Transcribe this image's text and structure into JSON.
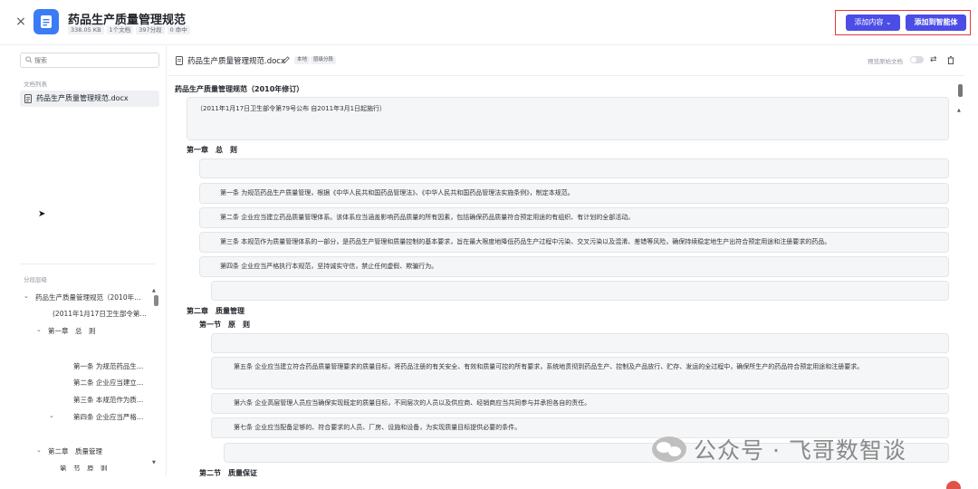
{
  "header": {
    "close": "×",
    "title": "药品生产质量管理规范",
    "meta": [
      "338.05 KB",
      "1个文档",
      "397分段",
      "0 命中"
    ],
    "add_content_label": "添加内容 ⌄",
    "add_agent_label": "添加到智能体"
  },
  "left": {
    "search_placeholder": "搜索",
    "doc_list_label": "文档列表",
    "doc_name": "药品生产质量管理规范.docx",
    "segment_label": "分段层级",
    "tree": [
      "药品生产质量管理规范（2010年…",
      "(2011年1月17日卫生部令第…",
      "第一章　总　则",
      "第一条 为规范药品生…",
      "第二条 企业应当建立…",
      "第三条 本规范作为质…",
      "第四条 企业应当严格…",
      "第二章　质量管理",
      "第　节　原　则"
    ]
  },
  "main": {
    "file_name": "药品生产质量管理规范.docx",
    "tag_local": "本地",
    "tag_level": "层级分段",
    "preview_label": "预览原始文档",
    "doc_title": "药品生产质量管理规范（2010年修订）",
    "intro": "（2011年1月17日卫生部令第79号公布 自2011年3月1日起施行）",
    "ch1": "第一章　总　则",
    "a1": "第一条 为规范药品生产质量管理，根据《中华人民共和国药品管理法》、《中华人民共和国药品管理法实施条例》，制定本规范。",
    "a2": "第二条 企业应当建立药品质量管理体系。该体系应当涵盖影响药品质量的所有因素，包括确保药品质量符合预定用途的有组织、有计划的全部活动。",
    "a3": "第三条 本规范作为质量管理体系的一部分，是药品生产管理和质量控制的基本要求，旨在最大限度地降低药品生产过程中污染、交叉污染以及混淆、差错等风险，确保持续稳定地生产出符合预定用途和注册要求的药品。",
    "a4": "第四条 企业应当严格执行本规范，坚持诚实守信，禁止任何虚假、欺骗行为。",
    "ch2": "第二章　质量管理",
    "sec1": "第一节　原　则",
    "a5": "第五条 企业应当建立符合药品质量管理要求的质量目标，将药品注册的有关安全、有效和质量可控的所有要求，系统地贯彻到药品生产、控制及产品放行、贮存、发运的全过程中，确保所生产的药品符合预定用途和注册要求。",
    "a6": "第六条 企业高层管理人员应当确保实现既定的质量目标，不同层次的人员以及供应商、经销商应当共同参与并承担各自的责任。",
    "a7": "第七条 企业应当配备足够的、符合要求的人员、厂房、设施和设备，为实现质量目标提供必要的条件。",
    "sec2": "第二节　质量保证"
  },
  "watermark": "公众号 · 飞哥数智谈",
  "colors": {
    "accent": "#4b4de6",
    "highlight": "#e53935",
    "doc_icon": "#3b7bf6"
  }
}
